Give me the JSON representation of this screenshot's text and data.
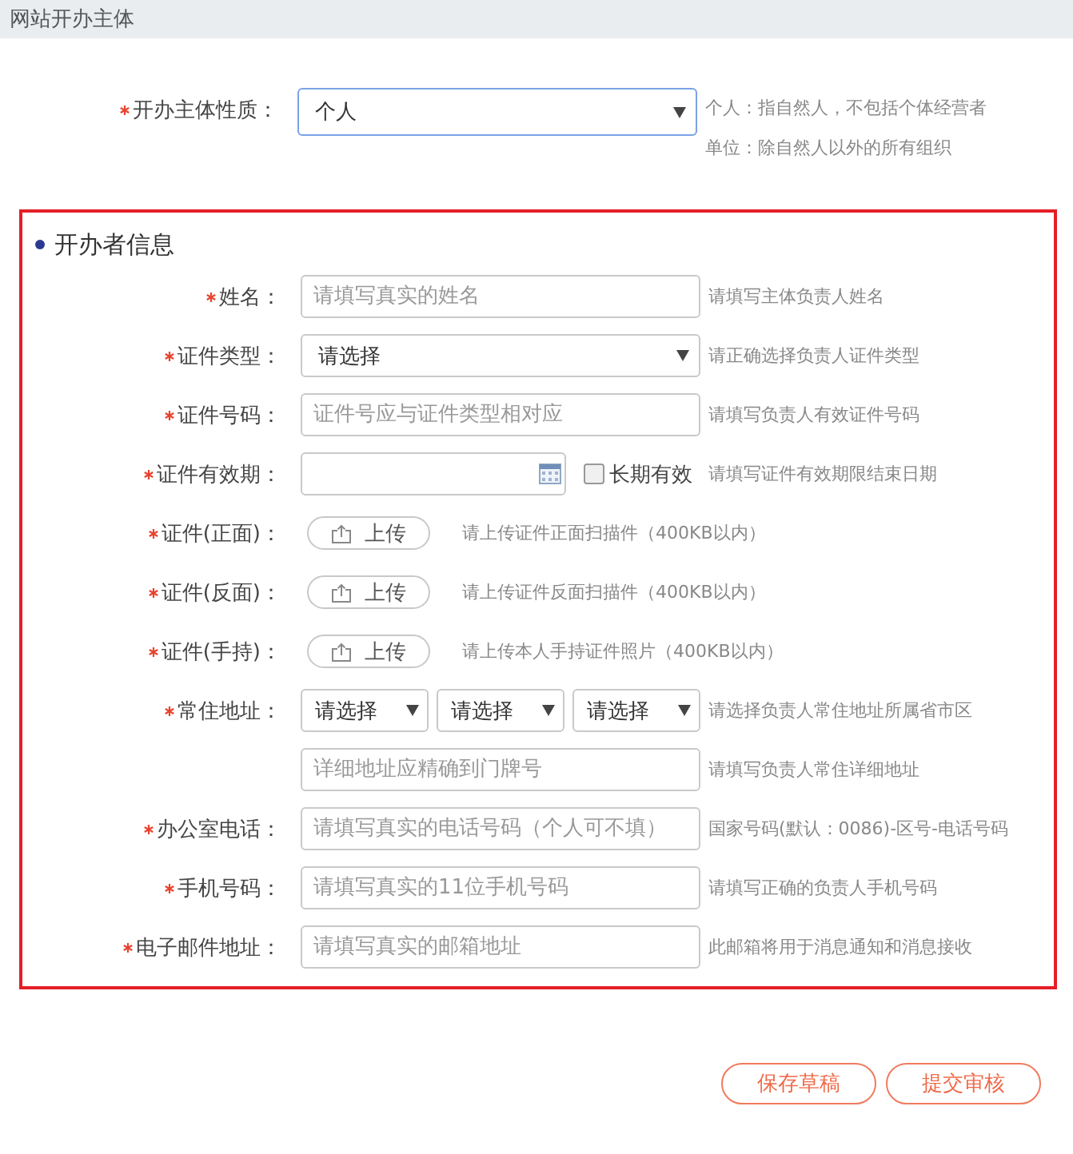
{
  "header": {
    "title": "网站开办主体"
  },
  "subject_type": {
    "label": "开办主体性质：",
    "required": true,
    "value": "个人",
    "hints": [
      "个人：指自然人，不包括个体经营者",
      "单位：除自然人以外的所有组织"
    ]
  },
  "section": {
    "title": "开办者信息",
    "rows": [
      {
        "kind": "input",
        "label": "姓名：",
        "required": true,
        "placeholder": "请填写真实的姓名",
        "hint": "请填写主体负责人姓名"
      },
      {
        "kind": "select",
        "label": "证件类型：",
        "required": true,
        "value": "请选择",
        "hint": "请正确选择负责人证件类型"
      },
      {
        "kind": "input",
        "label": "证件号码：",
        "required": true,
        "placeholder": "证件号应与证件类型相对应",
        "hint": "请填写负责人有效证件号码"
      },
      {
        "kind": "date",
        "label": "证件有效期：",
        "required": true,
        "checkbox": {
          "label": "长期有效",
          "checked": false
        },
        "hint": "请填写证件有效期限结束日期"
      },
      {
        "kind": "upload",
        "label": "证件(正面)：",
        "required": true,
        "button": "上传",
        "hint": "请上传证件正面扫描件（400KB以内）"
      },
      {
        "kind": "upload",
        "label": "证件(反面)：",
        "required": true,
        "button": "上传",
        "hint": "请上传证件反面扫描件（400KB以内）"
      },
      {
        "kind": "upload",
        "label": "证件(手持)：",
        "required": true,
        "button": "上传",
        "hint": "请上传本人手持证件照片（400KB以内）"
      },
      {
        "kind": "address",
        "label": "常住地址：",
        "required": true,
        "selects": [
          "请选择",
          "请选择",
          "请选择"
        ],
        "hint": "请选择负责人常住地址所属省市区"
      },
      {
        "kind": "input",
        "placeholder": "详细地址应精确到门牌号",
        "hint": "请填写负责人常住详细地址"
      },
      {
        "kind": "input",
        "label": "办公室电话：",
        "required": true,
        "placeholder": "请填写真实的电话号码（个人可不填）",
        "hint": "国家号码(默认：0086)-区号-电话号码"
      },
      {
        "kind": "input",
        "label": "手机号码：",
        "required": true,
        "placeholder": "请填写真实的11位手机号码",
        "hint": "请填写正确的负责人手机号码"
      },
      {
        "kind": "input",
        "label": "电子邮件地址：",
        "required": true,
        "placeholder": "请填写真实的邮箱地址",
        "hint": "此邮箱将用于消息通知和消息接收"
      }
    ]
  },
  "buttons": [
    "保存草稿",
    "提交审核"
  ]
}
